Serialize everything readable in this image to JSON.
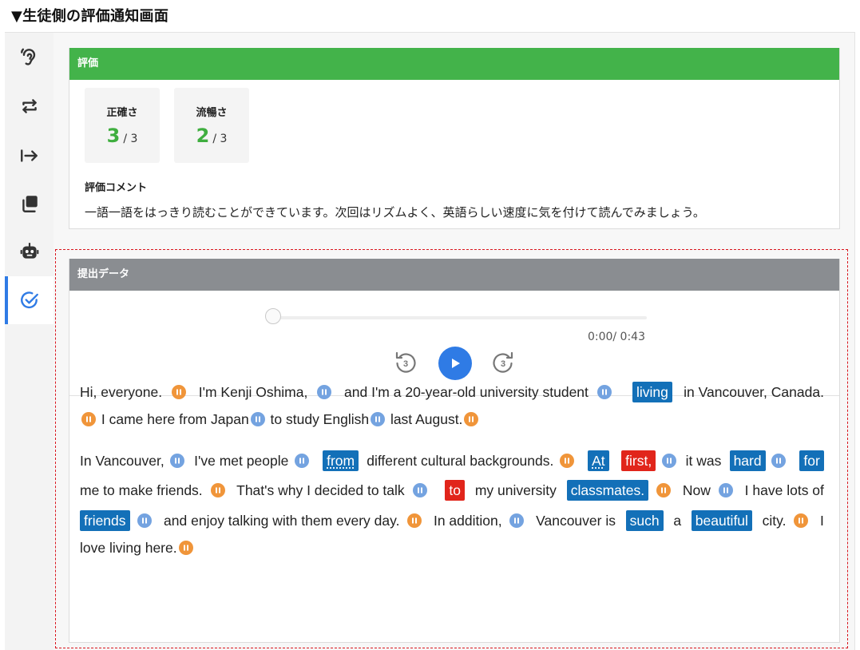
{
  "caption": "▼生徒側の評価通知画面",
  "sidebar": {
    "items": [
      {
        "icon": "ear-icon"
      },
      {
        "icon": "repeat-icon"
      },
      {
        "icon": "arrow-to-line-icon"
      },
      {
        "icon": "copy-icon"
      },
      {
        "icon": "robot-icon"
      },
      {
        "icon": "check-circle-icon",
        "active": true
      }
    ]
  },
  "evaluation": {
    "header": "評価",
    "scores": [
      {
        "label": "正確さ",
        "value": "3",
        "max": "/ 3"
      },
      {
        "label": "流暢さ",
        "value": "2",
        "max": "/ 3"
      }
    ],
    "comment_label": "評価コメント",
    "comment": "一語一語をはっきり読むことができています。次回はリズムよく、英語らしい速度に気を付けて読んでみましょう。"
  },
  "submission": {
    "header": "提出データ",
    "player": {
      "time": "0:00/ 0:43",
      "rewind_label": "3",
      "forward_label": "3",
      "progress": 0
    }
  },
  "colors": {
    "green_header": "#43b34a",
    "gray_header": "#8a8d91",
    "accent_blue": "#2f7be5",
    "highlight_blue": "#1370b8",
    "highlight_red": "#e1251b",
    "pause_orange": "#f0953a",
    "pause_blue": "#74a3e0"
  },
  "transcript": {
    "lines": [
      {
        "justify": true,
        "tokens": [
          {
            "t": "Hi, everyone."
          },
          {
            "pause": "orange"
          },
          {
            "t": " I'm Kenji Oshima,"
          },
          {
            "pause": "blue"
          },
          {
            "t": " and I'm a 20-year-old university student"
          },
          {
            "pause": "blue"
          },
          {
            "t": " "
          },
          {
            "t": "living",
            "hl": "blue"
          },
          {
            "t": " in Vancouver, Canada."
          }
        ]
      },
      {
        "justify": false,
        "tokens": [
          {
            "pause": "orange"
          },
          {
            "t": " I came here from Japan"
          },
          {
            "pause": "blue"
          },
          {
            "t": " to study English"
          },
          {
            "pause": "blue"
          },
          {
            "t": " last August."
          },
          {
            "pause": "orange"
          }
        ]
      },
      {
        "justify": true,
        "tokens": [
          {
            "t": "In Vancouver,"
          },
          {
            "pause": "blue"
          },
          {
            "t": " I've met people"
          },
          {
            "pause": "blue"
          },
          {
            "t": " "
          },
          {
            "t": "from",
            "hl": "blue",
            "dot": true
          },
          {
            "t": " different cultural backgrounds."
          },
          {
            "pause": "orange"
          },
          {
            "t": " "
          },
          {
            "t": "At",
            "hl": "blue",
            "dot": true
          },
          {
            "t": " "
          },
          {
            "t": "first,",
            "hl": "red"
          },
          {
            "pause": "blue"
          },
          {
            "t": " it was "
          },
          {
            "t": "hard",
            "hl": "blue"
          },
          {
            "pause": "blue"
          },
          {
            "t": " "
          },
          {
            "t": "for",
            "hl": "blue"
          }
        ]
      },
      {
        "justify": true,
        "tokens": [
          {
            "t": "me to make friends."
          },
          {
            "pause": "orange"
          },
          {
            "t": " That's why I decided to talk"
          },
          {
            "pause": "blue"
          },
          {
            "t": " "
          },
          {
            "t": "to",
            "hl": "red"
          },
          {
            "t": " my university "
          },
          {
            "t": "classmates.",
            "hl": "blue"
          },
          {
            "pause": "orange"
          },
          {
            "t": " Now"
          },
          {
            "pause": "blue"
          },
          {
            "t": " I have lots of"
          }
        ]
      },
      {
        "justify": true,
        "tokens": [
          {
            "t": "friends",
            "hl": "blue"
          },
          {
            "pause": "blue"
          },
          {
            "t": " and enjoy talking with them every day."
          },
          {
            "pause": "orange"
          },
          {
            "t": " In addition,"
          },
          {
            "pause": "blue"
          },
          {
            "t": " Vancouver is "
          },
          {
            "t": "such",
            "hl": "blue"
          },
          {
            "t": " a "
          },
          {
            "t": "beautiful",
            "hl": "blue"
          },
          {
            "t": " city."
          },
          {
            "pause": "orange"
          },
          {
            "t": " I"
          }
        ]
      },
      {
        "justify": false,
        "tokens": [
          {
            "t": "love living here."
          },
          {
            "pause": "orange"
          }
        ]
      }
    ]
  }
}
